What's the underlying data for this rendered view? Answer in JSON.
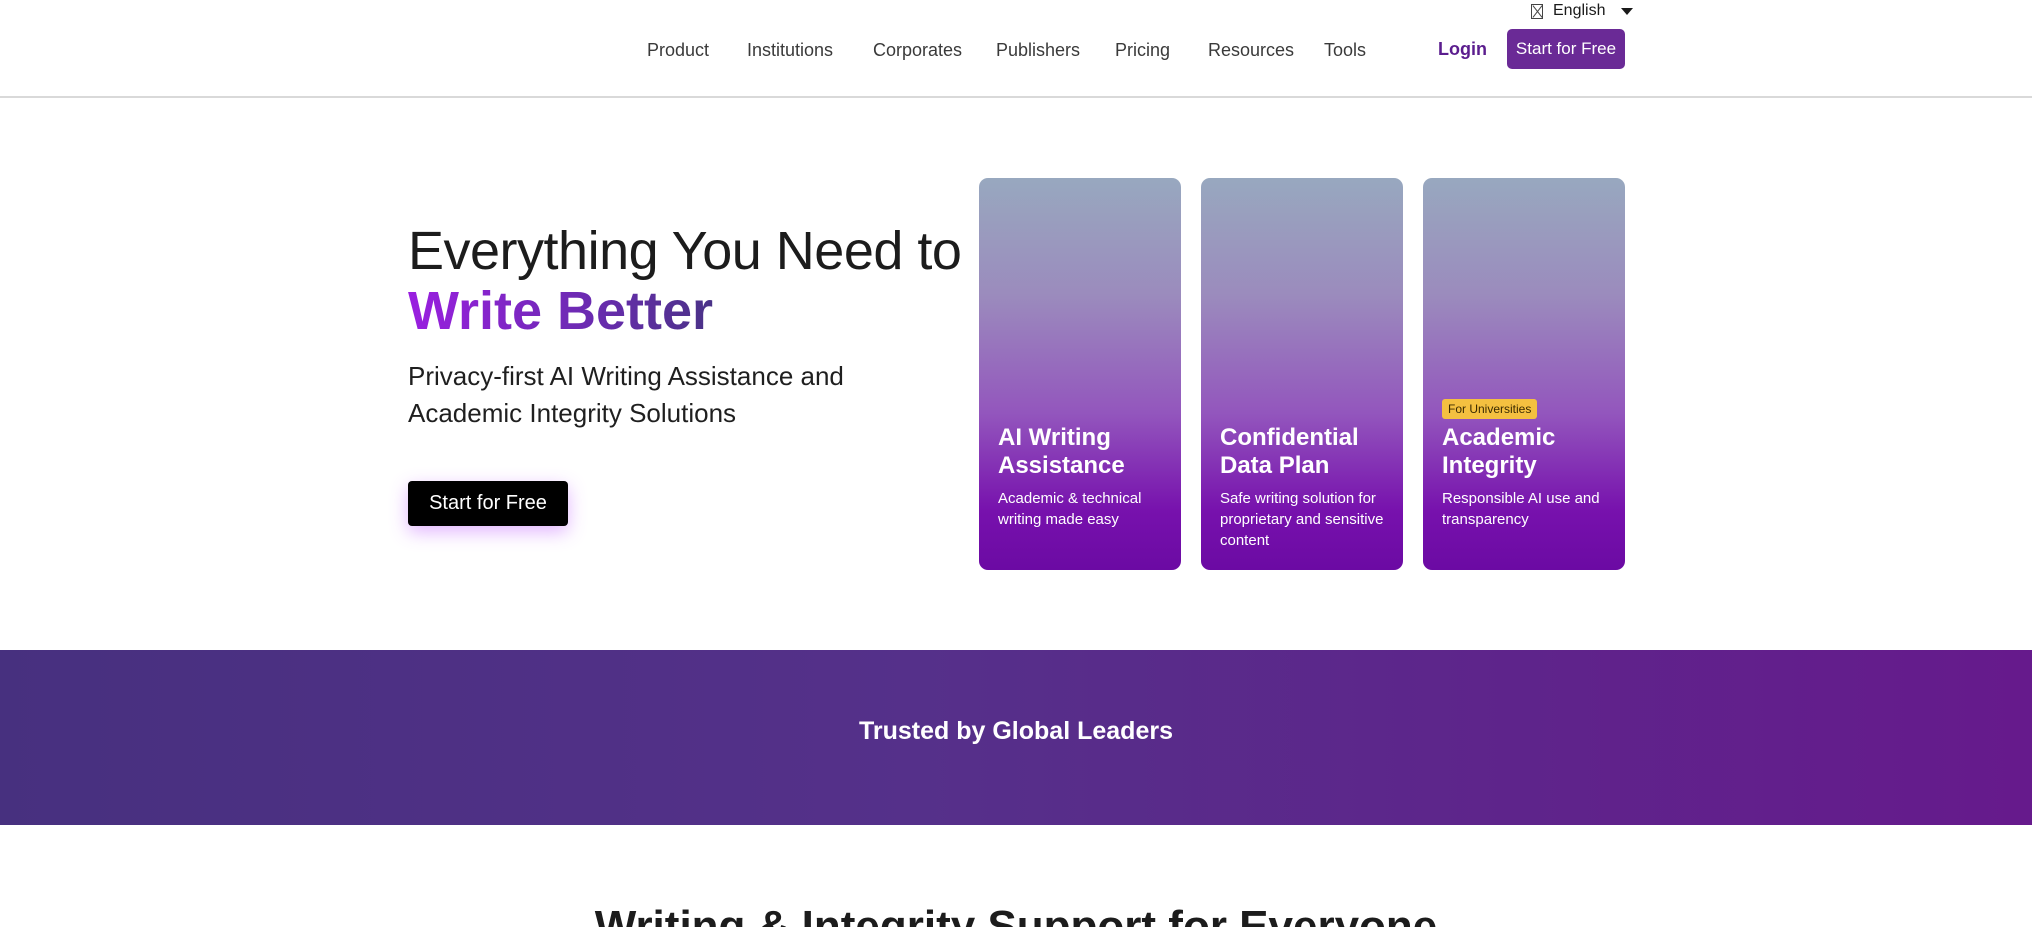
{
  "header": {
    "language": "English",
    "nav": [
      "Product",
      "Institutions",
      "Corporates",
      "Publishers",
      "Pricing",
      "Resources",
      "Tools"
    ],
    "login_label": "Login",
    "cta_label": "Start for Free"
  },
  "hero": {
    "title": "Everything You Need to",
    "accent": "Write Better",
    "subtitle": "Privacy-first AI Writing Assistance and Academic Integrity Solutions",
    "cta_label": "Start for Free",
    "accent_colors": [
      "#9a1fe0",
      "#4a3287"
    ]
  },
  "cards": [
    {
      "badge": "",
      "title": "AI Writing Assistance",
      "desc": "Academic & technical writing made easy"
    },
    {
      "badge": "",
      "title": "Confidential Data Plan",
      "desc": "Safe writing solution for proprietary and sensitive content"
    },
    {
      "badge": "For Universities",
      "title": "Academic Integrity",
      "desc": "Responsible AI use and transparency"
    }
  ],
  "band": {
    "title": "Trusted by Global Leaders"
  },
  "section": {
    "title": "Writing & Integrity Support for Everyone"
  },
  "colors": {
    "brand": "#6a2a96",
    "badge": "#f4c040",
    "band_start": "#47307f",
    "band_end": "#661a8c"
  }
}
